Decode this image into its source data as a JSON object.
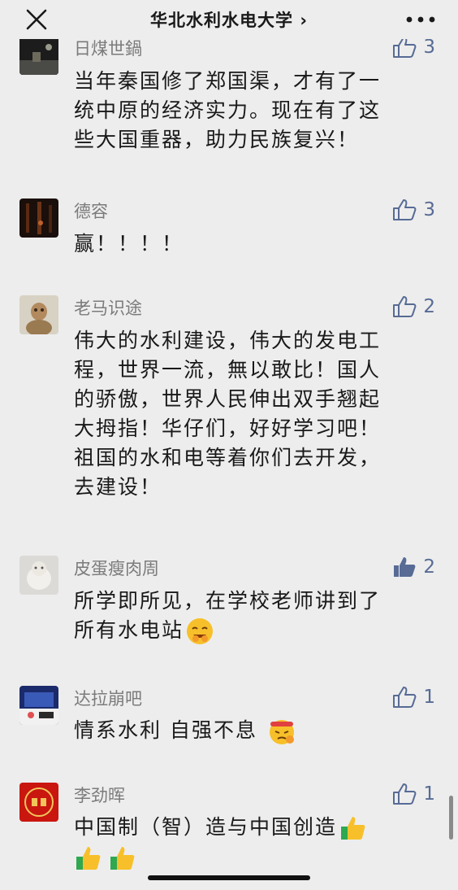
{
  "header": {
    "title": "华北水利水电大学 ›",
    "close_icon": "close-icon",
    "more_icon": "more-icon"
  },
  "comments": [
    {
      "name": "日煤世鍋",
      "likes": "3",
      "liked": false,
      "lines": [
        "当年秦国修了郑国渠，才有了一",
        "统中原的经济实力。现在有了这",
        "些大国重器，助力民族复兴！"
      ]
    },
    {
      "name": "德容",
      "likes": "3",
      "liked": false,
      "lines": [
        "赢！！！！"
      ]
    },
    {
      "name": "老马识途",
      "likes": "2",
      "liked": false,
      "lines": [
        "伟大的水利建设，伟大的发电工",
        "程，世界一流，無以敢比！国人",
        "的骄傲，世界人民伸出双手翘起",
        "大拇指！华仔们，好好学习吧！",
        "祖国的水和电等着你们去开发，",
        "去建设！"
      ]
    },
    {
      "name": "皮蛋瘦肉周",
      "likes": "2",
      "liked": true,
      "lines": [
        "所学即所见，在学校老师讲到了",
        "所有水电站"
      ]
    },
    {
      "name": "达拉崩吧",
      "likes": "1",
      "liked": false,
      "lines": [
        "情系水利 自强不息"
      ]
    },
    {
      "name": "李劲晖",
      "likes": "1",
      "liked": false,
      "lines": [
        "中国制（智）造与中国创造",
        ""
      ]
    }
  ],
  "colors": {
    "background": "#ededed",
    "like_blue": "#576b95",
    "name_gray": "#7b7b7b"
  }
}
